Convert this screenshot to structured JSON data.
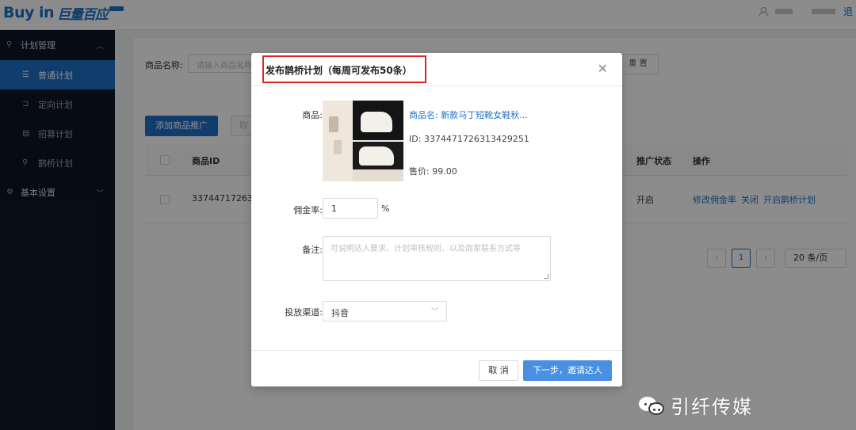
{
  "header": {
    "logo_en": "Buy in",
    "logo_cn": "巨量百应",
    "logout_text": "退"
  },
  "sidebar": {
    "groups": [
      {
        "label": "计划管理",
        "icon": "plan-icon",
        "expanded": true
      },
      {
        "label": "基本设置",
        "icon": "settings-icon",
        "expanded": false
      }
    ],
    "items": [
      {
        "label": "普通计划",
        "icon": "list-icon",
        "active": true
      },
      {
        "label": "定向计划",
        "icon": "target-icon"
      },
      {
        "label": "招募计划",
        "icon": "recruit-icon"
      },
      {
        "label": "鹊桥计划",
        "icon": "bridge-icon"
      }
    ]
  },
  "main": {
    "filter_label": "商品名称:",
    "filter_placeholder": "请输入商品名称",
    "reset_label": "重 置",
    "add_button": "添加商品推广",
    "ghost_button": "取",
    "columns": [
      "商品ID",
      "推广状态",
      "操作"
    ],
    "row": {
      "id": "33744717263",
      "status": "开启",
      "actions": [
        "修改佣金率",
        "关闭",
        "开启鹊桥计划"
      ]
    },
    "pager": {
      "current": "1",
      "page_size": "20 条/页"
    }
  },
  "modal": {
    "title": "发布鹊桥计划（每周可发布50条）",
    "product_label": "商品:",
    "product_name": "商品名: 新款马丁短靴女鞋秋...",
    "product_id": "ID: 3374471726313429251",
    "product_price": "售价: 99.00",
    "commission_label": "佣金率:",
    "commission_value": "1",
    "commission_unit": "%",
    "remark_label": "备注:",
    "remark_placeholder": "可说明达人要求、计划审核规则、以及商家联系方式等",
    "channel_label": "投放渠道:",
    "channel_value": "抖音",
    "cancel_label": "取 消",
    "next_label": "下一步，邀请达人"
  },
  "watermark": {
    "text": "引纤传媒"
  },
  "colors": {
    "accent": "#1f6fc6",
    "sidebar_bg": "#0e1526",
    "highlight_border": "#e02424"
  }
}
